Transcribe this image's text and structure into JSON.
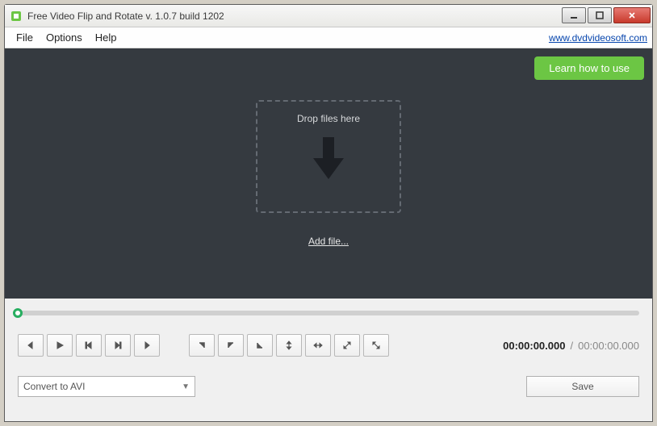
{
  "window": {
    "title": "Free Video Flip and Rotate v. 1.0.7 build 1202"
  },
  "menubar": {
    "items": [
      "File",
      "Options",
      "Help"
    ],
    "site_link": "www.dvdvideosoft.com"
  },
  "preview": {
    "learn_label": "Learn how to use",
    "drop_label": "Drop files here",
    "add_file_label": "Add file..."
  },
  "timecode": {
    "current": "00:00:00.000",
    "separator": "/",
    "total": "00:00:00.000"
  },
  "format": {
    "selected": "Convert to AVI"
  },
  "actions": {
    "save_label": "Save"
  }
}
